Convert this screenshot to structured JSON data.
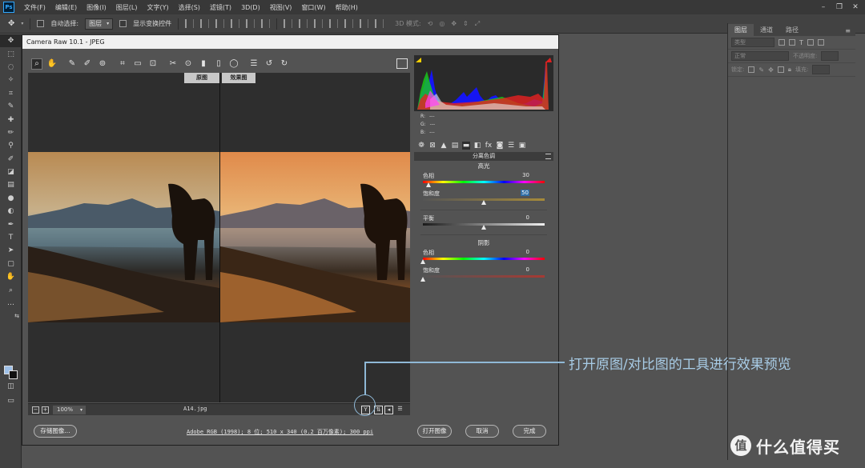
{
  "app": {
    "logo": "Ps",
    "menus": [
      "文件(F)",
      "编辑(E)",
      "图像(I)",
      "图层(L)",
      "文字(Y)",
      "选择(S)",
      "滤镜(T)",
      "3D(D)",
      "视图(V)",
      "窗口(W)",
      "帮助(H)"
    ]
  },
  "options_bar": {
    "auto_select_label": "自动选择:",
    "auto_select_value": "图层",
    "show_transform_label": "显示变换控件",
    "mode_3d_label": "3D 模式:"
  },
  "layers_panel": {
    "tabs": [
      "图层",
      "通道",
      "路径"
    ],
    "kind_placeholder": "类型",
    "blend_mode": "正常",
    "opacity_label": "不透明度:",
    "lock_label": "锁定:",
    "fill_label": "填充:"
  },
  "dialog": {
    "title": "Camera Raw 10.1  -  JPEG",
    "preview_label_original": "原图",
    "preview_label_result": "效果图",
    "zoom": "100%",
    "filename": "A14.jpg",
    "workflow_info": "Adobe RGB (1998); 8 位; 510 x 340 (0.2 百万像素); 300 ppi",
    "buttons": {
      "save": "存储图像...",
      "open": "打开图像",
      "cancel": "取消",
      "done": "完成"
    }
  },
  "readout": {
    "r_label": "R:",
    "g_label": "G:",
    "b_label": "B:",
    "r_value": "---",
    "g_value": "---",
    "b_value": "---"
  },
  "split_toning": {
    "title": "分离色调",
    "highlights": {
      "section": "高光",
      "hue_label": "色相",
      "hue_value": "30",
      "saturation_label": "饱和度",
      "saturation_value": "50"
    },
    "balance": {
      "label": "平衡",
      "value": "0"
    },
    "shadows": {
      "section": "阴影",
      "hue_label": "色相",
      "hue_value": "0",
      "saturation_label": "饱和度",
      "saturation_value": "0"
    }
  },
  "annotation": {
    "text": "打开原图/对比图的工具进行效果预览"
  },
  "watermark": {
    "logo": "值",
    "text": "什么值得买"
  },
  "colors": {
    "accent_callout": "#8fb8d6",
    "selected_value": "#2f6ea6",
    "histogram_bg": "#2a2a2a"
  }
}
